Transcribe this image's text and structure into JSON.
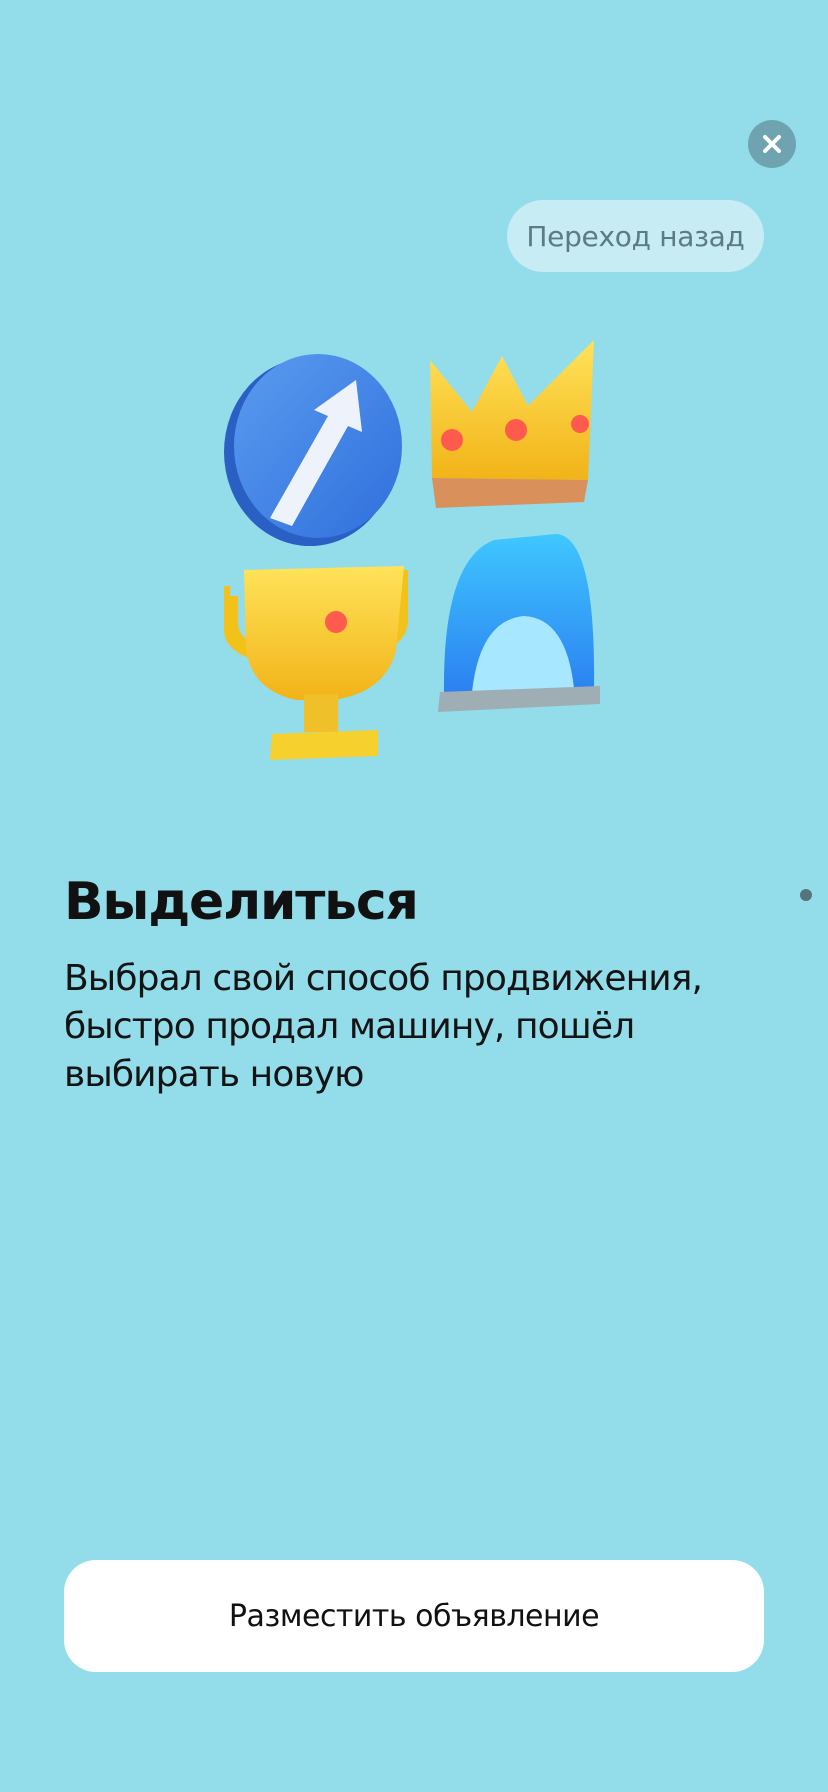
{
  "header": {
    "close_icon": "close-icon",
    "back_label": "Переход назад"
  },
  "slide": {
    "title": "Выделиться",
    "description": "Выбрал свой способ продвижения, быстро продал машину, пошёл выбирать новую",
    "illustration_icons": [
      "arrow-up-icon",
      "crown-icon",
      "trophy-icon",
      "beacon-icon"
    ]
  },
  "pagination": {
    "indicator": "page-dot"
  },
  "footer": {
    "cta_label": "Разместить объявление"
  },
  "colors": {
    "background": "#93dcea",
    "close_button": "#6fa3b0",
    "back_pill": "#c7ecf3",
    "cta_background": "#ffffff"
  }
}
